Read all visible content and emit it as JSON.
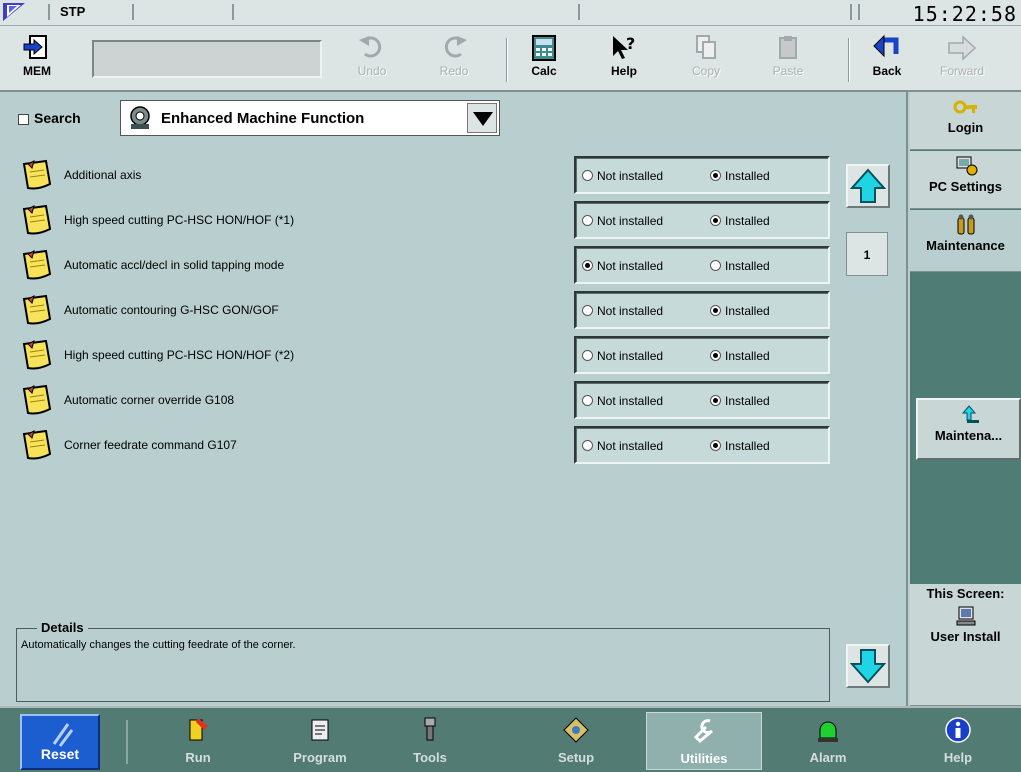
{
  "status_bar": {
    "mode": "STP",
    "clock": "15:22:58"
  },
  "toolbar": {
    "mem_label": "MEM",
    "undo_label": "Undo",
    "redo_label": "Redo",
    "calc_label": "Calc",
    "help_label": "Help",
    "copy_label": "Copy",
    "paste_label": "Paste",
    "back_label": "Back",
    "forward_label": "Forward"
  },
  "search": {
    "label": "Search",
    "checked": false
  },
  "category_dropdown": {
    "selected": "Enhanced Machine Function"
  },
  "radio_labels": {
    "not_installed": "Not installed",
    "installed": "Installed"
  },
  "features": [
    {
      "name": "Additional axis",
      "installed": true
    },
    {
      "name": "High speed cutting PC-HSC HON/HOF (*1)",
      "installed": true
    },
    {
      "name": "Automatic accl/decl in solid tapping mode",
      "installed": false
    },
    {
      "name": "Automatic contouring G-HSC GON/GOF",
      "installed": true
    },
    {
      "name": "High speed cutting PC-HSC HON/HOF (*2)",
      "installed": true
    },
    {
      "name": "Automatic corner override G108",
      "installed": true
    },
    {
      "name": "Corner feedrate command G107",
      "installed": true
    }
  ],
  "page_number": "1",
  "details": {
    "title": "Details",
    "text": "Automatically changes the cutting feedrate of the corner."
  },
  "sidebar": {
    "login": "Login",
    "pc_settings": "PC Settings",
    "maintenance": "Maintenance",
    "maintena_sub": "Maintena...",
    "this_screen": "This Screen:",
    "user_install": "User Install"
  },
  "navbar": {
    "reset": "Reset",
    "run": "Run",
    "program": "Program",
    "tools": "Tools",
    "setup": "Setup",
    "utilities": "Utilities",
    "alarm": "Alarm",
    "help": "Help",
    "active": "Utilities"
  },
  "colors": {
    "background": "#b9cfcf",
    "sidebar": "#4f7d75",
    "navbar": "#527b73",
    "reset": "#1c5ecf",
    "arrow_cyan": "#1fd5e5"
  }
}
